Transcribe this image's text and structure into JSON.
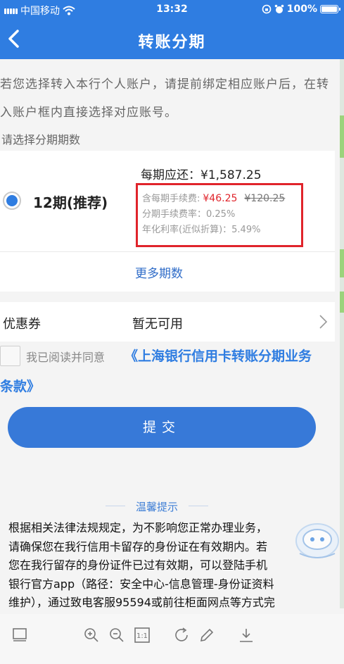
{
  "status_bar": {
    "carrier": "中国移动",
    "time": "13:32",
    "battery": "100%"
  },
  "nav": {
    "title": "转账分期"
  },
  "notice": {
    "line1": "若您选择转入本行个人账户，请提前绑定相应账户后，在转",
    "line2": "入账户框内直接选择对应账号。"
  },
  "choose_label": "请选择分期期数",
  "period_option": {
    "name": "12期(推荐)",
    "monthly_payment": "每期应还：¥1,587.25",
    "fee_label": "含每期手续费:",
    "fee_value": "¥46.25",
    "fee_original": "¥120.25",
    "rate": "分期手续费率：0.25%",
    "apr": "年化利率(近似折算)：5.49%"
  },
  "more_periods": "更多期数",
  "coupon": {
    "label": "优惠券",
    "value": "暂无可用"
  },
  "agreement": {
    "text": "我已阅读并同意",
    "link_part1": "《上海银行信用卡转账分期业务",
    "link_part2": "条款》"
  },
  "submit_label": "提交",
  "tips": {
    "title": "温馨提示",
    "lines": [
      "根据相关法律法规规定，为不影响您正常办理业务，",
      "请确保您在我行信用卡留存的身份证在有效期内。若",
      "您在我行留存的身份证件已过有效期，可以登陆手机",
      "银行官方app（路径：安全中心-信息管理-身份证资料",
      "维护），通过致电客服95594或前往柜面网点等方式完"
    ]
  },
  "toolbar": {
    "icons": [
      "layout-icon",
      "zoom-in-icon",
      "zoom-out-icon",
      "actual-size-icon",
      "rotate-icon",
      "pen-icon",
      "download-icon"
    ],
    "actual_size_label": "1:1"
  },
  "colors": {
    "brand_blue": "#2f7de1",
    "highlight_red": "#e0242b"
  }
}
